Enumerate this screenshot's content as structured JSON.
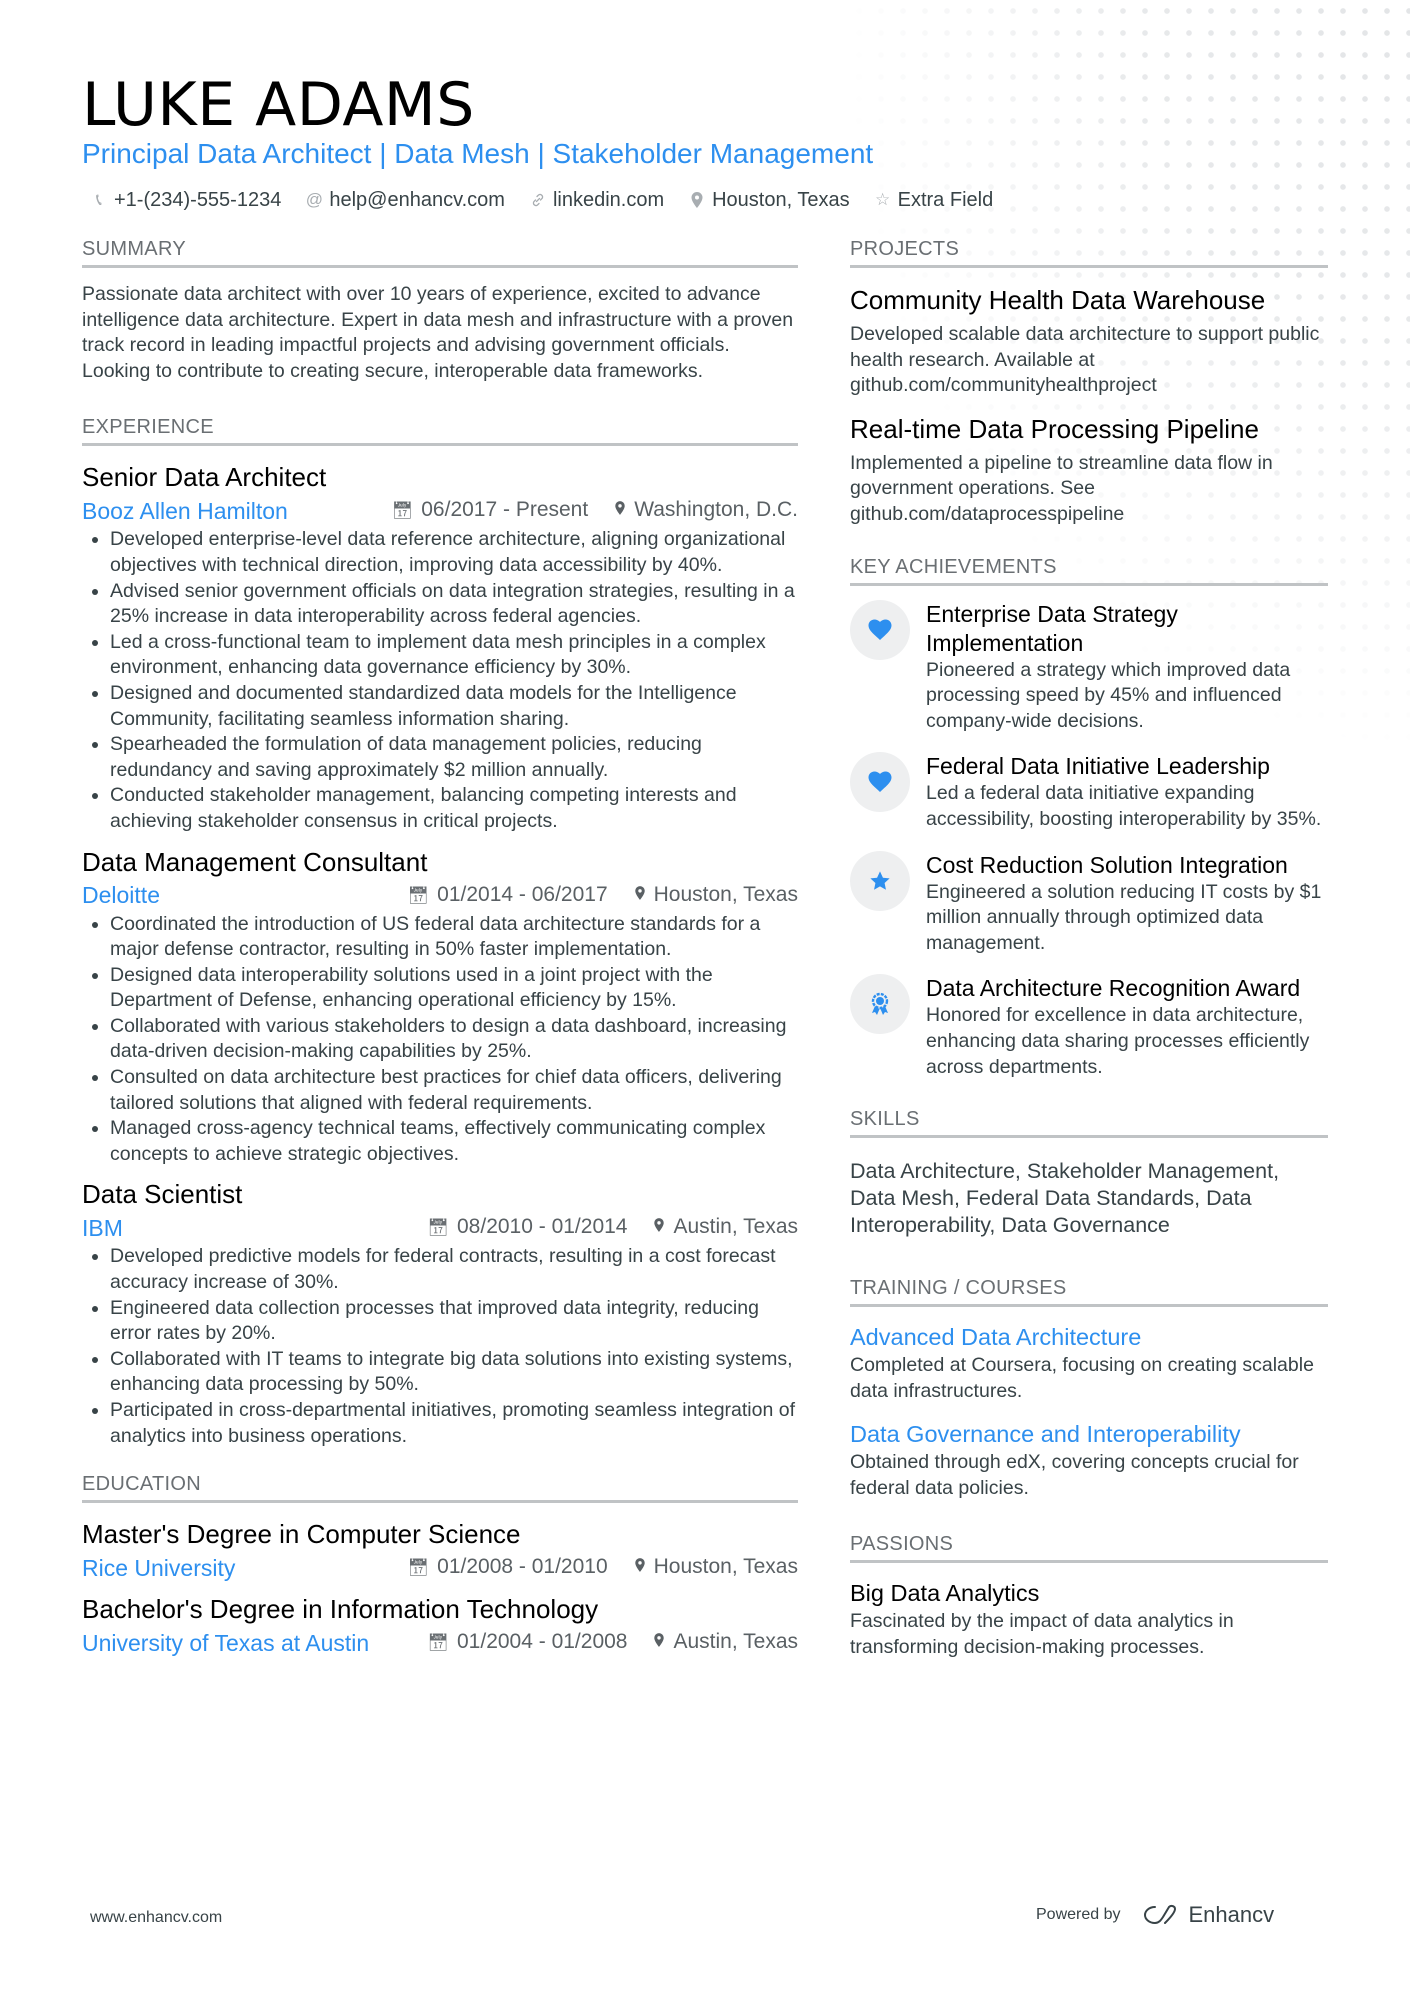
{
  "header": {
    "name": "LUKE ADAMS",
    "headline": "Principal Data Architect | Data Mesh | Stakeholder Management",
    "contacts": [
      {
        "icon": "phone-icon",
        "text": "+1-(234)-555-1234"
      },
      {
        "icon": "at-icon",
        "text": "help@enhancv.com"
      },
      {
        "icon": "link-icon",
        "text": "linkedin.com"
      },
      {
        "icon": "location-icon",
        "text": "Houston, Texas"
      },
      {
        "icon": "star-outline-icon",
        "text": "Extra Field"
      }
    ]
  },
  "summary": {
    "title": "SUMMARY",
    "text": "Passionate data architect with over 10 years of experience, excited to advance intelligence data architecture. Expert in data mesh and infrastructure with a proven track record in leading impactful projects and advising government officials. Looking to contribute to creating secure, interoperable data frameworks."
  },
  "experience": {
    "title": "EXPERIENCE",
    "jobs": [
      {
        "title": "Senior Data Architect",
        "company": "Booz Allen Hamilton",
        "dates": "06/2017 - Present",
        "location": "Washington, D.C.",
        "bullets": [
          "Developed enterprise-level data reference architecture, aligning organizational objectives with technical direction, improving data accessibility by 40%.",
          "Advised senior government officials on data integration strategies, resulting in a 25% increase in data interoperability across federal agencies.",
          "Led a cross-functional team to implement data mesh principles in a complex environment, enhancing data governance efficiency by 30%.",
          "Designed and documented standardized data models for the Intelligence Community, facilitating seamless information sharing.",
          "Spearheaded the formulation of data management policies, reducing redundancy and saving approximately $2 million annually.",
          "Conducted stakeholder management, balancing competing interests and achieving stakeholder consensus in critical projects."
        ]
      },
      {
        "title": "Data Management Consultant",
        "company": "Deloitte",
        "dates": "01/2014 - 06/2017",
        "location": "Houston, Texas",
        "bullets": [
          "Coordinated the introduction of US federal data architecture standards for a major defense contractor, resulting in 50% faster implementation.",
          "Designed data interoperability solutions used in a joint project with the Department of Defense, enhancing operational efficiency by 15%.",
          "Collaborated with various stakeholders to design a data dashboard, increasing data-driven decision-making capabilities by 25%.",
          "Consulted on data architecture best practices for chief data officers, delivering tailored solutions that aligned with federal requirements.",
          "Managed cross-agency technical teams, effectively communicating complex concepts to achieve strategic objectives."
        ]
      },
      {
        "title": "Data Scientist",
        "company": "IBM",
        "dates": "08/2010 - 01/2014",
        "location": "Austin, Texas",
        "bullets": [
          "Developed predictive models for federal contracts, resulting in a cost forecast accuracy increase of 30%.",
          "Engineered data collection processes that improved data integrity, reducing error rates by 20%.",
          "Collaborated with IT teams to integrate big data solutions into existing systems, enhancing data processing by 50%.",
          "Participated in cross-departmental initiatives, promoting seamless integration of analytics into business operations."
        ]
      }
    ]
  },
  "education": {
    "title": "EDUCATION",
    "items": [
      {
        "degree": "Master's Degree in Computer Science",
        "school": "Rice University",
        "dates": "01/2008 - 01/2010",
        "location": "Houston, Texas"
      },
      {
        "degree": "Bachelor's Degree in Information Technology",
        "school": "University of Texas at Austin",
        "dates": "01/2004 - 01/2008",
        "location": "Austin, Texas"
      }
    ]
  },
  "projects": {
    "title": "PROJECTS",
    "items": [
      {
        "title": "Community Health Data Warehouse",
        "desc": "Developed scalable data architecture to support public health research. Available at github.com/communityhealthproject"
      },
      {
        "title": "Real-time Data Processing Pipeline",
        "desc": "Implemented a pipeline to streamline data flow in government operations. See github.com/dataprocesspipeline"
      }
    ]
  },
  "achievements": {
    "title": "KEY ACHIEVEMENTS",
    "items": [
      {
        "icon": "heart-icon",
        "title": "Enterprise Data Strategy Implementation",
        "desc": "Pioneered a strategy which improved data processing speed by 45% and influenced company-wide decisions."
      },
      {
        "icon": "heart-icon",
        "title": "Federal Data Initiative Leadership",
        "desc": "Led a federal data initiative expanding accessibility, boosting interoperability by 35%."
      },
      {
        "icon": "star-icon",
        "title": "Cost Reduction Solution Integration",
        "desc": "Engineered a solution reducing IT costs by $1 million annually through optimized data management."
      },
      {
        "icon": "award-icon",
        "title": "Data Architecture Recognition Award",
        "desc": "Honored for excellence in data architecture, enhancing data sharing processes efficiently across departments."
      }
    ]
  },
  "skills": {
    "title": "SKILLS",
    "text": "Data Architecture, Stakeholder Management, Data Mesh, Federal Data Standards, Data Interoperability, Data Governance"
  },
  "training": {
    "title": "TRAINING / COURSES",
    "items": [
      {
        "title": "Advanced Data Architecture",
        "desc": "Completed at Coursera, focusing on creating scalable data infrastructures."
      },
      {
        "title": "Data Governance and Interoperability",
        "desc": "Obtained through edX, covering concepts crucial for federal data policies."
      }
    ]
  },
  "passions": {
    "title": "PASSIONS",
    "items": [
      {
        "title": "Big Data Analytics",
        "desc": "Fascinated by the impact of data analytics in transforming decision-making processes."
      }
    ]
  },
  "footer": {
    "website": "www.enhancv.com",
    "powered_by": "Powered by",
    "brand": "Enhancv"
  },
  "colors": {
    "accent": "#2d8fef",
    "text": "#384347",
    "heading": "#000000",
    "rule": "#c0c3c5",
    "icon_bg": "#eeeff0"
  }
}
